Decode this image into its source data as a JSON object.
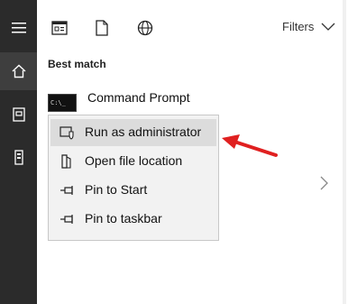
{
  "left_rail": {
    "items": [
      {
        "icon": "hamburger-menu-icon"
      },
      {
        "icon": "home-icon",
        "active": true
      },
      {
        "icon": "document-icon"
      },
      {
        "icon": "device-icon"
      }
    ]
  },
  "topbar": {
    "icons": [
      "apps-icon",
      "documents-icon",
      "web-icon"
    ],
    "filters_label": "Filters"
  },
  "best_match": {
    "section_title": "Best match",
    "result_label": "Command Prompt",
    "result_icon_text": "C:\\_"
  },
  "context_menu": {
    "items": [
      {
        "label": "Run as administrator",
        "icon": "shield-run-icon",
        "hover": true
      },
      {
        "label": "Open file location",
        "icon": "folder-location-icon"
      },
      {
        "label": "Pin to Start",
        "icon": "pin-icon"
      },
      {
        "label": "Pin to taskbar",
        "icon": "pin-icon"
      }
    ]
  },
  "colors": {
    "rail_bg": "#2b2b2b",
    "menu_bg": "#f2f2f2",
    "hover_bg": "#dcdcdc",
    "arrow": "#e02020"
  }
}
